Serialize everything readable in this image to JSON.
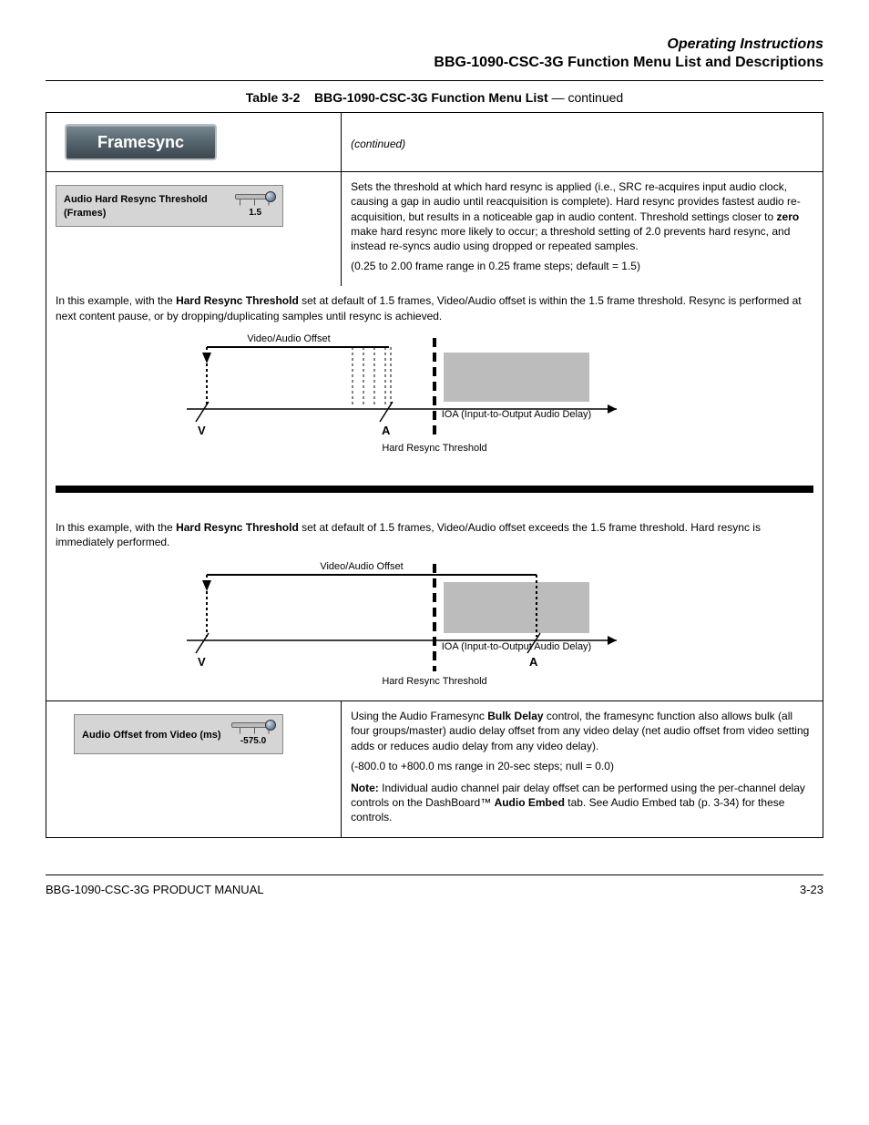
{
  "header": {
    "chapter_label": "Operating Instructions",
    "section_title": "BBG-1090-CSC-3G Function Menu List and Descriptions"
  },
  "table_caption": {
    "label": "Table 3-2",
    "title": "BBG-1090-CSC-3G Function Menu List",
    "continued": " — continued"
  },
  "framesync": {
    "button_label": "Framesync",
    "continued_note": "(continued)"
  },
  "resync": {
    "control_label": "Audio Hard Resync Threshold (Frames)",
    "control_value": "1.5",
    "desc1_pre": "Sets the threshold at which hard resync is applied (i.e., SRC re-acquires input audio clock, causing a gap in audio until reacquisition is complete). Hard resync provides fastest audio re-acquisition, but results in a noticeable gap in audio content. Threshold settings closer to ",
    "desc1_zero": "zero",
    "desc1_post": " make hard resync more likely to occur; a threshold setting of 2.0 prevents hard resync, and instead re-syncs audio using dropped or repeated samples.",
    "range": "(0.25 to 2.00 frame range in 0.25 frame steps; default = 1.5)"
  },
  "diagram1": {
    "caption_a": "In this example, with the ",
    "caption_b": "Hard Resync Threshold",
    "caption_c": " set at default of 1.5 frames, Video/Audio offset is within the 1.5 frame threshold. Resync is performed at next content pause, or by dropping/duplicating samples until resync is achieved.",
    "label_va_offset": "Video/Audio Offset",
    "label_v": "V",
    "label_a": "A",
    "label_threshold": "Hard Resync Threshold",
    "label_ioa": "IOA (Input-to-Output Audio Delay)"
  },
  "diagram2": {
    "caption_a": "In this example, with the ",
    "caption_b": "Hard Resync Threshold",
    "caption_c": " set at default of 1.5 frames, Video/Audio offset exceeds the 1.5 frame threshold. Hard resync is immediately performed.",
    "label_va_offset": "Video/Audio Offset",
    "label_v": "V",
    "label_a": "A",
    "label_threshold": "Hard Resync Threshold",
    "label_ioa": "IOA (Input-to-Output Audio Delay)"
  },
  "offset": {
    "control_label": "Audio Offset from Video (ms)",
    "control_value": "-575.0",
    "desc_a": "Using the Audio Framesync ",
    "desc_b": "Bulk Delay",
    "desc_c": " control, the framesync function also allows bulk (all four groups/master) audio delay offset from any video delay (net audio offset from video setting adds or reduces audio delay from any video delay).",
    "range": "(-800.0 to +800.0 ms range in 20-sec steps; null = 0.0)",
    "note_label": "Note:",
    "note_text_a": " Individual audio channel pair delay offset can be performed using the per-channel delay controls on the DashBoard™",
    "note_text_b": "Audio Embed",
    "note_text_c": " tab. See ",
    "note_text_d": "Audio Embed tab",
    "note_text_e": " (p. ",
    "note_text_f": "3-34",
    "note_text_g": ") for these controls."
  },
  "footer": {
    "left": "BBG-1090-CSC-3G PRODUCT MANUAL",
    "right": "3-23"
  }
}
